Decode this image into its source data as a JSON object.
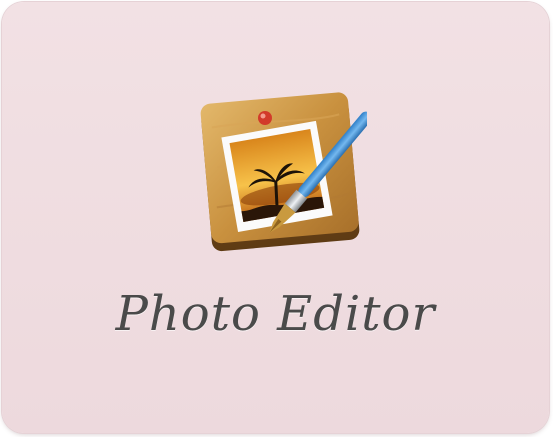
{
  "app": {
    "name": "Photo Editor",
    "icon": "photo-editor-icon",
    "background_color": "#f0dde1",
    "title_color": "#4a4a4a"
  }
}
